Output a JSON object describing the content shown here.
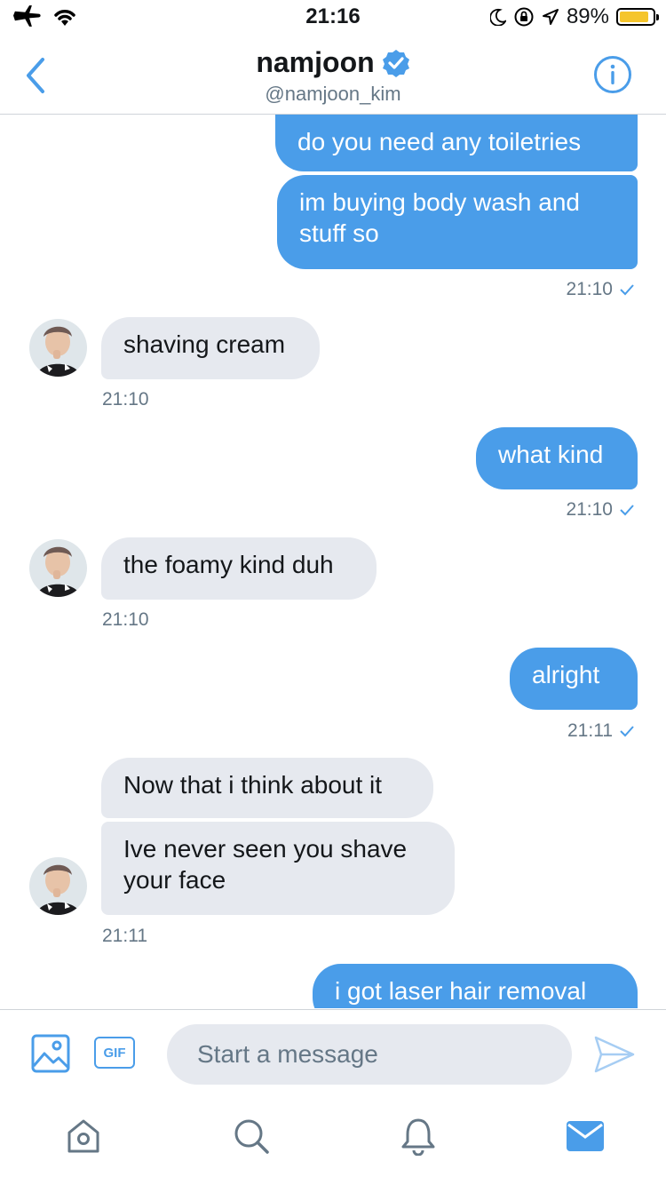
{
  "status_bar": {
    "time": "21:16",
    "battery_text": "89%",
    "battery_level": 0.89,
    "battery_color": "#f5c52c"
  },
  "header": {
    "name": "namjoon",
    "handle": "@namjoon_kim"
  },
  "messages": [
    {
      "side": "out",
      "text": "do you need any toiletries"
    },
    {
      "side": "out",
      "text": "im buying body wash and\nstuff so",
      "time": "21:10"
    },
    {
      "side": "in",
      "text": "shaving cream",
      "time": "21:10"
    },
    {
      "side": "out",
      "text": "what kind",
      "time": "21:10"
    },
    {
      "side": "in",
      "text": "the foamy kind duh",
      "time": "21:10"
    },
    {
      "side": "out",
      "text": "alright",
      "time": "21:11"
    },
    {
      "side": "in",
      "text": "Now that i think about it"
    },
    {
      "side": "in",
      "text": "Ive never seen you shave\nyour face",
      "time": "21:11"
    },
    {
      "side": "out",
      "text": "i got laser hair removal"
    }
  ],
  "composer": {
    "gif_label": "GIF",
    "placeholder": "Start a message"
  },
  "tab_bar": {
    "icons": [
      "home-icon",
      "search-icon",
      "bell-icon",
      "mail-icon"
    ]
  },
  "colors": {
    "accent": "#4a9de9",
    "outgoing_bubble": "#4a9de9",
    "incoming_bubble": "#e6e9ef",
    "muted_text": "#657786"
  }
}
